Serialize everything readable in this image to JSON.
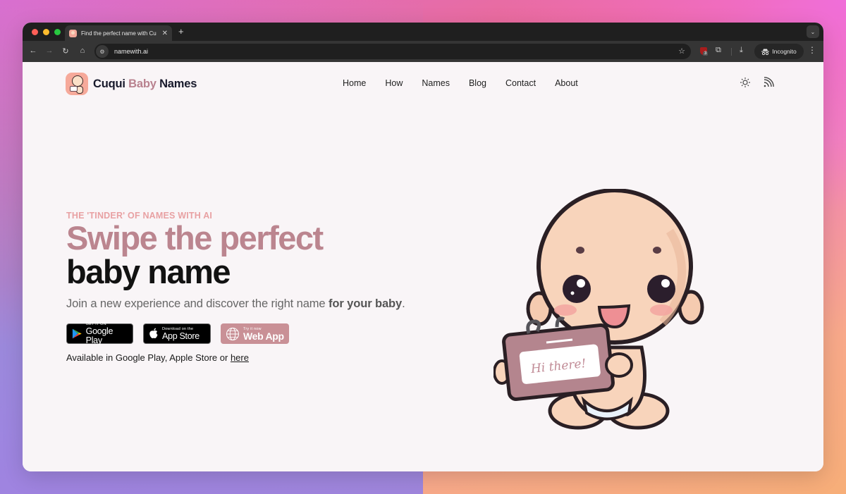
{
  "browser": {
    "tab_title": "Find the perfect name with Cu",
    "tab_close": "✕",
    "new_tab": "+",
    "url": "namewith.ai",
    "extension_badge": "3",
    "incognito_label": "Incognito",
    "icons": {
      "back": "←",
      "forward": "→",
      "reload": "↻",
      "home": "⌂",
      "star": "☆",
      "menu": "⋮",
      "tab_dropdown": "⌄",
      "download": "⤓",
      "puzzle": "⧉",
      "site_info": "⚙"
    }
  },
  "site": {
    "logo": {
      "part1": "Cuqui ",
      "part2": "Baby",
      "part3": " Names"
    },
    "nav": [
      "Home",
      "How",
      "Names",
      "Blog",
      "Contact",
      "About"
    ],
    "colors": {
      "accent": "#bb858f",
      "eyebrow": "#e8a1a3",
      "heading": "#121212",
      "webapp_button": "#c99096"
    }
  },
  "hero": {
    "eyebrow": "THE 'TINDER' OF NAMES WITH AI",
    "headline_line1": "Swipe the perfect",
    "headline_line2": "baby name",
    "subtitle_regular": "Join a new experience and discover the right name ",
    "subtitle_bold": "for your baby",
    "subtitle_end": ".",
    "buttons": {
      "google_play": {
        "small": "GET IT ON",
        "big": "Google Play"
      },
      "app_store": {
        "small": "Download on the",
        "big": "App Store"
      },
      "web_app": {
        "small": "Try it now",
        "big": "Web App"
      }
    },
    "availability_text": "Available in Google Play, Apple Store or ",
    "availability_link": "here",
    "illustration_sign_text": "Hi there!"
  }
}
